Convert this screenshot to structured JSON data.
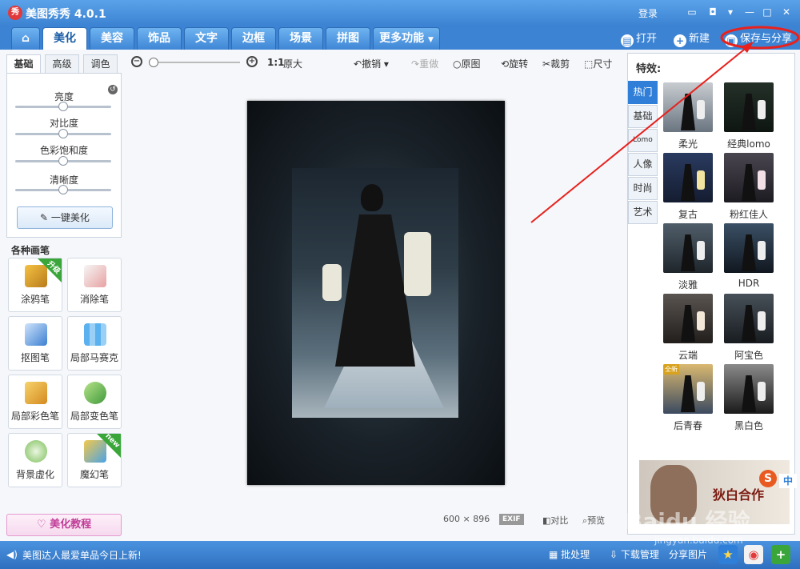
{
  "window": {
    "title": "美图秀秀 4.0.1",
    "logo_text": "秀",
    "login": "登录"
  },
  "main_tabs": [
    "美化",
    "美容",
    "饰品",
    "文字",
    "边框",
    "场景",
    "拼图",
    "更多功能"
  ],
  "header_actions": {
    "open": "打开",
    "new": "新建",
    "save_share": "保存与分享"
  },
  "left_panel": {
    "subtabs": [
      "基础",
      "高级",
      "调色"
    ],
    "sliders": [
      {
        "label": "亮度",
        "value": 0.5
      },
      {
        "label": "对比度",
        "value": 0.5
      },
      {
        "label": "色彩饱和度",
        "value": 0.5
      },
      {
        "label": "清晰度",
        "value": 0.5
      }
    ],
    "one_key_button": "一键美化",
    "brushes_title": "各种画笔",
    "tools": [
      {
        "label": "涂鸦笔",
        "badge": "升级"
      },
      {
        "label": "消除笔",
        "badge": ""
      },
      {
        "label": "抠图笔",
        "badge": ""
      },
      {
        "label": "局部马赛克",
        "badge": ""
      },
      {
        "label": "局部彩色笔",
        "badge": ""
      },
      {
        "label": "局部变色笔",
        "badge": ""
      },
      {
        "label": "背景虚化",
        "badge": ""
      },
      {
        "label": "魔幻笔",
        "badge": "new"
      }
    ],
    "tutorial": "美化教程"
  },
  "toolbar": {
    "ratio": "1:1",
    "original_size": "原大",
    "undo": "撤销",
    "redo": "重做",
    "original": "原图",
    "rotate": "旋转",
    "crop": "裁剪",
    "resize": "尺寸"
  },
  "canvas": {
    "width": "600",
    "times": "×",
    "height": "896",
    "exif": "EXIF",
    "compare": "对比",
    "preview": "预览"
  },
  "right_panel": {
    "title": "特效:",
    "vtabs": [
      "热门",
      "基础",
      "Lomo",
      "人像",
      "时尚",
      "艺术"
    ],
    "effects": [
      "柔光",
      "经典lomo",
      "复古",
      "粉红佳人",
      "淡雅",
      "HDR",
      "云端",
      "阿宝色",
      "后青春",
      "黑白色"
    ],
    "new_badge": "全新",
    "ad_text": "狄白合作",
    "ad_badge": "S"
  },
  "status_bar": {
    "message": "美图达人最爱单品今日上新!",
    "batch": "批处理",
    "download": "下载管理",
    "share": "分享图片"
  },
  "watermark": {
    "main": "Baidu 经验",
    "sub": "jingyan.baidu.com",
    "ime": "中"
  },
  "colors": {
    "accent_blue": "#2f7ed8",
    "annotation_red": "#e8211d",
    "badge_green": "#3aa63a"
  }
}
